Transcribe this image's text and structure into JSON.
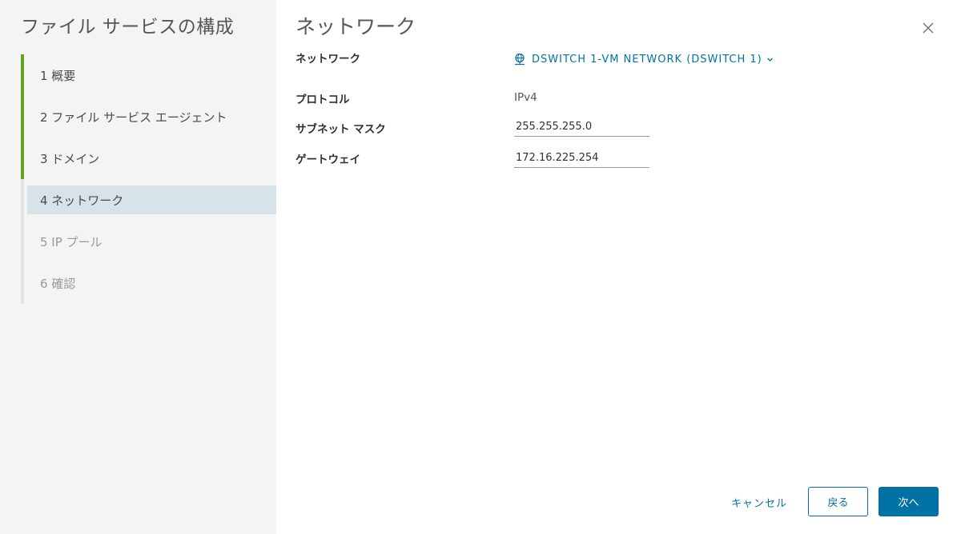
{
  "wizard": {
    "title": "ファイル サービスの構成",
    "steps": [
      {
        "label": "1 概要",
        "state": "done"
      },
      {
        "label": "2 ファイル サービス エージェント",
        "state": "done"
      },
      {
        "label": "3 ドメイン",
        "state": "done"
      },
      {
        "label": "4 ネットワーク",
        "state": "active"
      },
      {
        "label": "5 IP プール",
        "state": "disabled"
      },
      {
        "label": "6 確認",
        "state": "disabled"
      }
    ]
  },
  "page": {
    "title": "ネットワーク",
    "close_icon": "close-icon"
  },
  "form": {
    "network": {
      "label": "ネットワーク",
      "value": "DSWITCH 1-VM NETWORK (DSWITCH 1)",
      "icon": "globe-network-icon"
    },
    "protocol": {
      "label": "プロトコル",
      "value": "IPv4"
    },
    "subnet_mask": {
      "label": "サブネット マスク",
      "value": "255.255.255.0"
    },
    "gateway": {
      "label": "ゲートウェイ",
      "value": "172.16.225.254"
    }
  },
  "footer": {
    "cancel_label": "キャンセル",
    "back_label": "戻る",
    "next_label": "次へ"
  },
  "colors": {
    "accent": "#0072a3",
    "done_step": "#62a420",
    "active_step_bg": "#d8e3e9",
    "sidebar_bg": "#f4f4f4"
  }
}
